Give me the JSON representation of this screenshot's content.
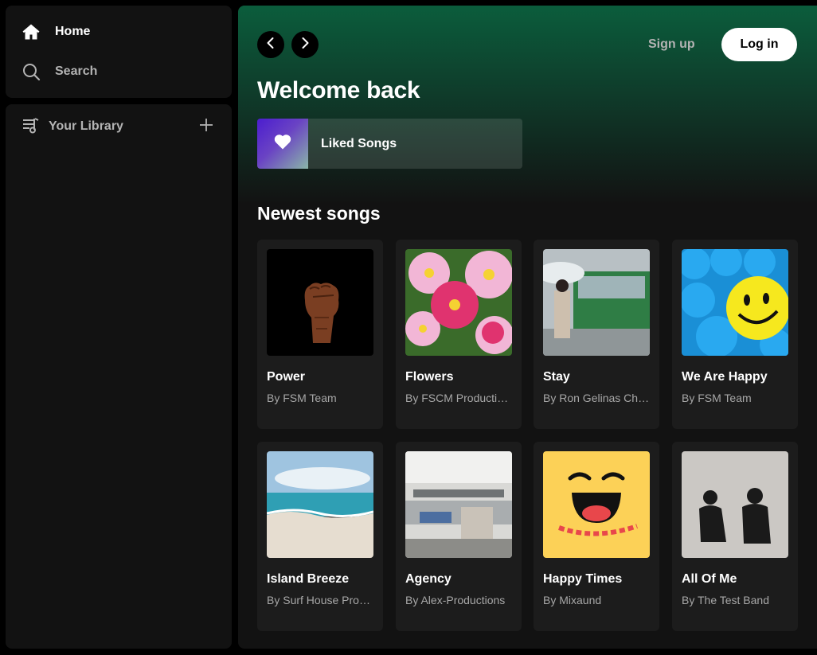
{
  "sidebar": {
    "nav": [
      {
        "label": "Home",
        "icon": "home-icon"
      },
      {
        "label": "Search",
        "icon": "search-icon"
      }
    ],
    "library": {
      "label": "Your Library",
      "icon": "library-icon",
      "add_icon": "plus-icon"
    }
  },
  "header": {
    "back_icon": "chevron-left-icon",
    "forward_icon": "chevron-right-icon",
    "signup_label": "Sign up",
    "login_label": "Log in"
  },
  "main": {
    "title": "Welcome back",
    "liked": {
      "label": "Liked Songs",
      "icon": "heart-icon"
    },
    "newest_title": "Newest songs",
    "songs": [
      {
        "title": "Power",
        "artist": "By FSM Team",
        "art": "raised-fist"
      },
      {
        "title": "Flowers",
        "artist": "By FSCM Productions",
        "art": "pink-flowers"
      },
      {
        "title": "Stay",
        "artist": "By Ron Gelinas Chillout Lounge",
        "art": "woman-umbrella-bus"
      },
      {
        "title": "We Are Happy",
        "artist": "By FSM Team",
        "art": "smiley-balls"
      },
      {
        "title": "Island Breeze",
        "artist": "By Surf House Productions",
        "art": "beach"
      },
      {
        "title": "Agency",
        "artist": "By Alex-Productions",
        "art": "office"
      },
      {
        "title": "Happy Times",
        "artist": "By Mixaund",
        "art": "happy-times-smiley"
      },
      {
        "title": "All Of Me",
        "artist": "By The Test Band",
        "art": "two-men"
      }
    ]
  },
  "colors": {
    "background": "#000000",
    "panel": "#121212",
    "card": "#1c1c1c",
    "header_gradient": "#0b5d3c",
    "text_secondary": "#a7a7a7"
  }
}
